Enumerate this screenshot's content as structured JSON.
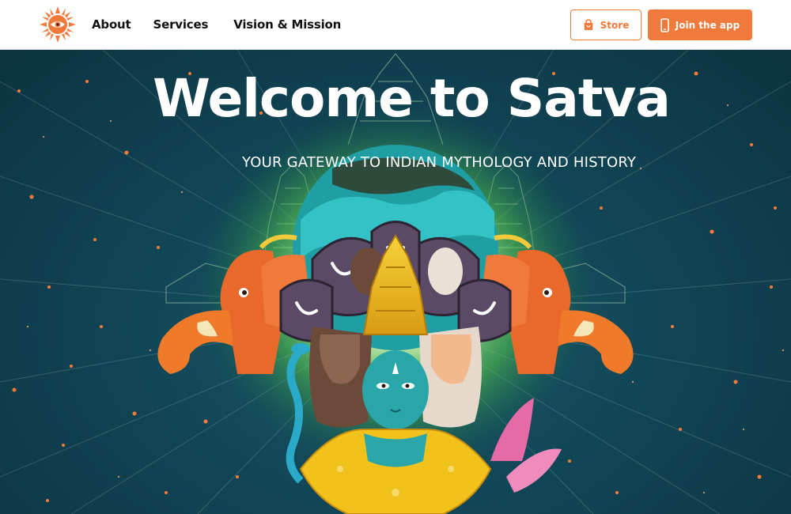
{
  "nav": {
    "logo_icon": "sun-eye-logo-icon",
    "links": [
      {
        "label": "About"
      },
      {
        "label": "Services"
      },
      {
        "label": "Vision & Mission"
      }
    ],
    "store_button": {
      "label": "Store",
      "icon": "shopping-bag-icon"
    },
    "join_button": {
      "label": "Join the app",
      "icon": "smartphone-icon"
    }
  },
  "hero": {
    "title": "Welcome to Satva",
    "subtitle": "YOUR GATEWAY TO INDIAN MYTHOLOGY AND HISTORY"
  },
  "colors": {
    "brand_orange": "#f07a3c",
    "hero_background": "#114656",
    "text_dark": "#111111",
    "text_light": "#ffffff"
  }
}
